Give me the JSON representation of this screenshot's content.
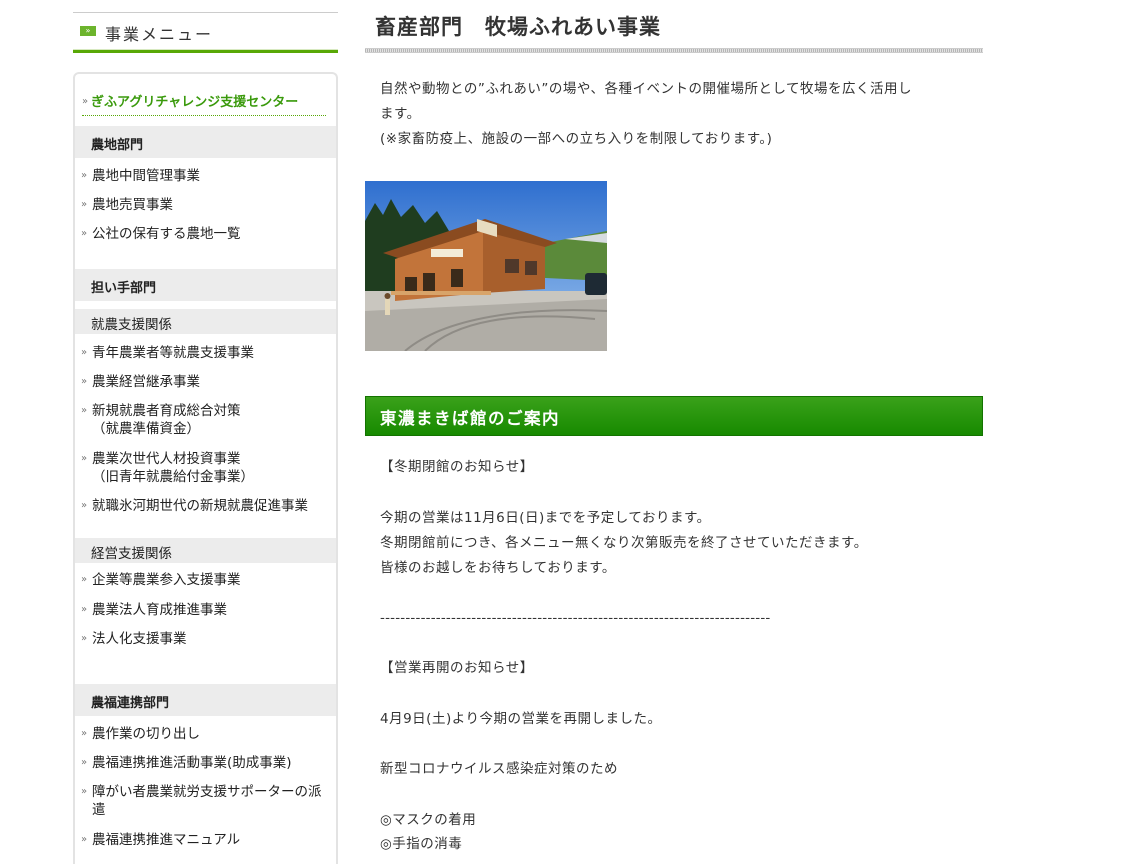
{
  "sidebar": {
    "menu_title": "事業メニュー",
    "menu_chip": "»",
    "feature_link": "ぎふアグリチャレンジ支援センター",
    "arrow": "»",
    "sections": [
      {
        "title": "農地部門"
      },
      {
        "title": "担い手部門"
      },
      {
        "title": "農福連携部門"
      }
    ],
    "subsections": [
      {
        "title": "就農支援関係"
      },
      {
        "title": "経営支援関係"
      }
    ],
    "farmland_items": [
      "農地中間管理事業",
      "農地売買事業",
      "公社の保有する農地一覧"
    ],
    "shunou_items": [
      {
        "line1": "青年農業者等就農支援事業",
        "line2": ""
      },
      {
        "line1": "農業経営継承事業",
        "line2": ""
      },
      {
        "line1": "新規就農者育成総合対策",
        "line2": "（就農準備資金）"
      },
      {
        "line1": "農業次世代人材投資事業",
        "line2": "（旧青年就農給付金事業）"
      },
      {
        "line1": "就職氷河期世代の新規就農促進事業",
        "line2": ""
      }
    ],
    "keiei_items": [
      "企業等農業参入支援事業",
      "農業法人育成推進事業",
      "法人化支援事業"
    ],
    "noufuku_items": [
      {
        "line1": "農作業の切り出し",
        "line2": ""
      },
      {
        "line1": "農福連携推進活動事業(助成事業)",
        "line2": ""
      },
      {
        "line1": "障がい者農業就労支援サポーターの派",
        "line2": "遣"
      },
      {
        "line1": "農福連携推進マニュアル",
        "line2": ""
      }
    ]
  },
  "main": {
    "title": "畜産部門　牧場ふれあい事業",
    "intro": [
      "自然や動物との”ふれあい”の場や、各種イベントの開催場所として牧場を広く活用し",
      "ます。",
      "(※家畜防疫上、施設の一部への立ち入りを制限しております。)"
    ],
    "section_title": "東濃まきば館のご案内",
    "lines": [
      "【冬期閉館のお知らせ】",
      "今期の営業は11月6日(日)までを予定しております。",
      "冬期閉館前につき、各メニュー無くなり次第販売を終了させていただきます。",
      "皆様のお越しをお待ちしております。",
      "-----------------------------------------------------------------------------",
      "【営業再開のお知らせ】",
      "4月9日(土)より今期の営業を再開しました。",
      "新型コロナウイルス感染症対策のため",
      "◎マスクの着用",
      "◎手指の消毒"
    ]
  }
}
